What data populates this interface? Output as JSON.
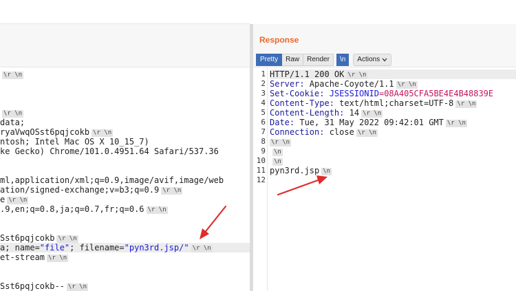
{
  "request": {
    "lines": [
      {
        "text": "",
        "tags": "\\r \\n"
      },
      {
        "text": "",
        "tags": "\\r \\n"
      },
      {
        "text": "data;",
        "tags": ""
      },
      {
        "text": "ryaVwqOSst6pqjcokb",
        "tags": "\\r \\n"
      },
      {
        "text": "ntosh; Intel Mac OS X 10_15_7)",
        "tags": ""
      },
      {
        "text": "ke Gecko) Chrome/101.0.4951.64 Safari/537.36",
        "tags": ""
      },
      {
        "text": "ml,application/xml;q=0.9,image/avif,image/web",
        "tags": ""
      },
      {
        "text": "ation/signed-exchange;v=b3;q=0.9",
        "tags": "\\r \\n"
      },
      {
        "text": "e",
        "tags": "\\r \\n"
      },
      {
        "text": ".9,en;q=0.8,ja;q=0.7,fr;q=0.6",
        "tags": "\\r \\n"
      },
      {
        "text": "Sst6pqjcokb",
        "tags": "\\r \\n"
      },
      {
        "pre": "a; name=",
        "q1": "\"file\"",
        "mid": "; filename=",
        "q2": "\"pyn3rd.jsp/\"",
        "tags": "\\r \\n"
      },
      {
        "text": "et-stream",
        "tags": "\\r \\n"
      },
      {
        "text": "Sst6pqjcokb--",
        "tags": "\\r \\n"
      }
    ]
  },
  "response": {
    "title": "Response",
    "toolbar": {
      "pretty": "Pretty",
      "raw": "Raw",
      "render": "Render",
      "newline": "\\n",
      "actions": "Actions"
    },
    "lines": [
      {
        "num": "1",
        "text": "HTTP/1.1 200 OK",
        "tags": "\\r \\n"
      },
      {
        "num": "2",
        "key": "Server:",
        "val": " Apache-Coyote/1.1",
        "tags": "\\r \\n"
      },
      {
        "num": "3",
        "key": "Set-Cookie:",
        "ck": " JSESSIONID",
        "cv": "=08A405CFA5BE4E4B48839E"
      },
      {
        "num": "4",
        "key": "Content-Type:",
        "val": " text/html;charset=UTF-8",
        "tags": "\\r \\n"
      },
      {
        "num": "5",
        "key": "Content-Length:",
        "val": " 14",
        "tags": "\\r \\n"
      },
      {
        "num": "6",
        "key": "Date:",
        "val": " Tue, 31 May 2022 09:42:01 GMT",
        "tags": "\\r \\n"
      },
      {
        "num": "7",
        "key": "Connection:",
        "val": " close",
        "tags": "\\r \\n"
      },
      {
        "num": "8",
        "tags": "\\r \\n"
      },
      {
        "num": "9",
        "tags": "\\n"
      },
      {
        "num": "10",
        "tags": "\\n"
      },
      {
        "num": "11",
        "text": "pyn3rd.jsp",
        "tags": "\\n"
      },
      {
        "num": "12"
      }
    ]
  },
  "colors": {
    "accent": "#e8692b",
    "annotation": "#e02b2b",
    "selected": "#3e6db8"
  }
}
